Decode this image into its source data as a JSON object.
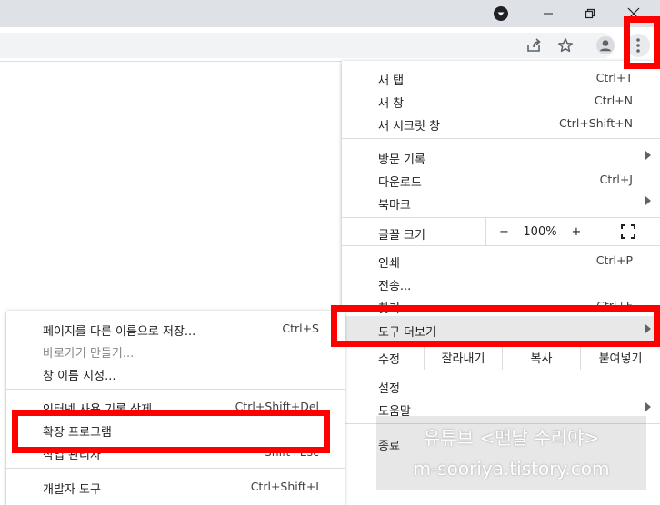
{
  "main_menu": {
    "items": [
      {
        "label": "새 탭",
        "shortcut": "Ctrl+T"
      },
      {
        "label": "새 창",
        "shortcut": "Ctrl+N"
      },
      {
        "label": "새 시크릿 창",
        "shortcut": "Ctrl+Shift+N"
      },
      {
        "label": "방문 기록",
        "shortcut": ""
      },
      {
        "label": "다운로드",
        "shortcut": "Ctrl+J"
      },
      {
        "label": "북마크",
        "shortcut": ""
      },
      {
        "label": "인쇄",
        "shortcut": "Ctrl+P"
      },
      {
        "label": "전송...",
        "shortcut": ""
      },
      {
        "label": "찾기",
        "shortcut": "Ctrl+F"
      },
      {
        "label": "도구 더보기",
        "shortcut": ""
      },
      {
        "label": "설정",
        "shortcut": ""
      },
      {
        "label": "도움말",
        "shortcut": ""
      },
      {
        "label": "종료",
        "shortcut": ""
      }
    ],
    "zoom": {
      "label": "글꼴 크기",
      "minus": "−",
      "value": "100%",
      "plus": "+"
    },
    "edit": {
      "label": "수정",
      "cut": "잘라내기",
      "copy": "복사",
      "paste": "붙여넣기"
    }
  },
  "sub_menu": {
    "items": [
      {
        "label": "페이지를 다른 이름으로 저장...",
        "shortcut": "Ctrl+S"
      },
      {
        "label": "바로가기 만들기...",
        "shortcut": ""
      },
      {
        "label": "창 이름 지정...",
        "shortcut": ""
      },
      {
        "label": "인터넷 사용 기록 삭제...",
        "shortcut": "Ctrl+Shift+Del"
      },
      {
        "label": "확장 프로그램",
        "shortcut": ""
      },
      {
        "label": "작업 관리자",
        "shortcut": "Shift+Esc"
      },
      {
        "label": "개발자 도구",
        "shortcut": "Ctrl+Shift+I"
      }
    ]
  },
  "watermark": {
    "line1": "유튜브 <맨날 수리야>",
    "line2": "m-sooriya.tistory.com"
  },
  "colors": {
    "highlight": "#ff0000",
    "titlebar": "#dee1e6",
    "hover": "#e8e8e9"
  }
}
